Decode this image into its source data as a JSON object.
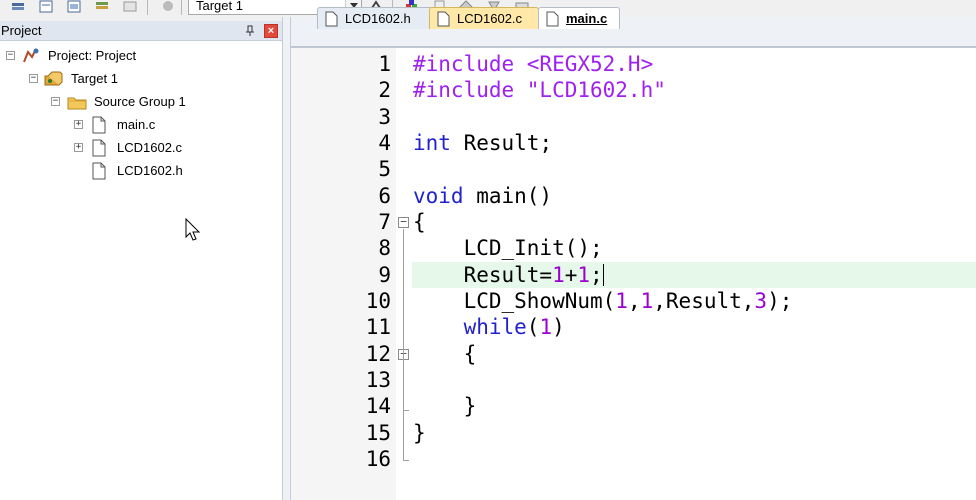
{
  "toolbar": {
    "target_select": "Target 1"
  },
  "project_panel": {
    "title": "Project",
    "tree": [
      {
        "label": "Project: Project",
        "expander": "−",
        "icon": "project-icon"
      },
      {
        "label": "Target 1",
        "expander": "−",
        "icon": "target-icon"
      },
      {
        "label": "Source Group 1",
        "expander": "−",
        "icon": "folder-icon"
      },
      {
        "label": "main.c",
        "expander": "+",
        "icon": "file-icon"
      },
      {
        "label": "LCD1602.c",
        "expander": "+",
        "icon": "file-icon"
      },
      {
        "label": "LCD1602.h",
        "expander": "",
        "icon": "file-icon"
      }
    ]
  },
  "tabs": [
    {
      "label": "LCD1602.h",
      "state": "inactive"
    },
    {
      "label": "LCD1602.c",
      "state": "modified"
    },
    {
      "label": "main.c",
      "state": "active"
    }
  ],
  "editor": {
    "line_numbers": [
      "1",
      "2",
      "3",
      "4",
      "5",
      "6",
      "7",
      "8",
      "9",
      "10",
      "11",
      "12",
      "13",
      "14",
      "15",
      "16"
    ],
    "current_line": 9
  },
  "colors": {
    "keyword": "#2222cc",
    "preprocessor": "#a020f0",
    "number": "#9b00d0",
    "current_line_bg": "#e6f8ea",
    "active_tab_bg": "#ffffff",
    "modified_tab_bg": "#ffe8a8"
  }
}
